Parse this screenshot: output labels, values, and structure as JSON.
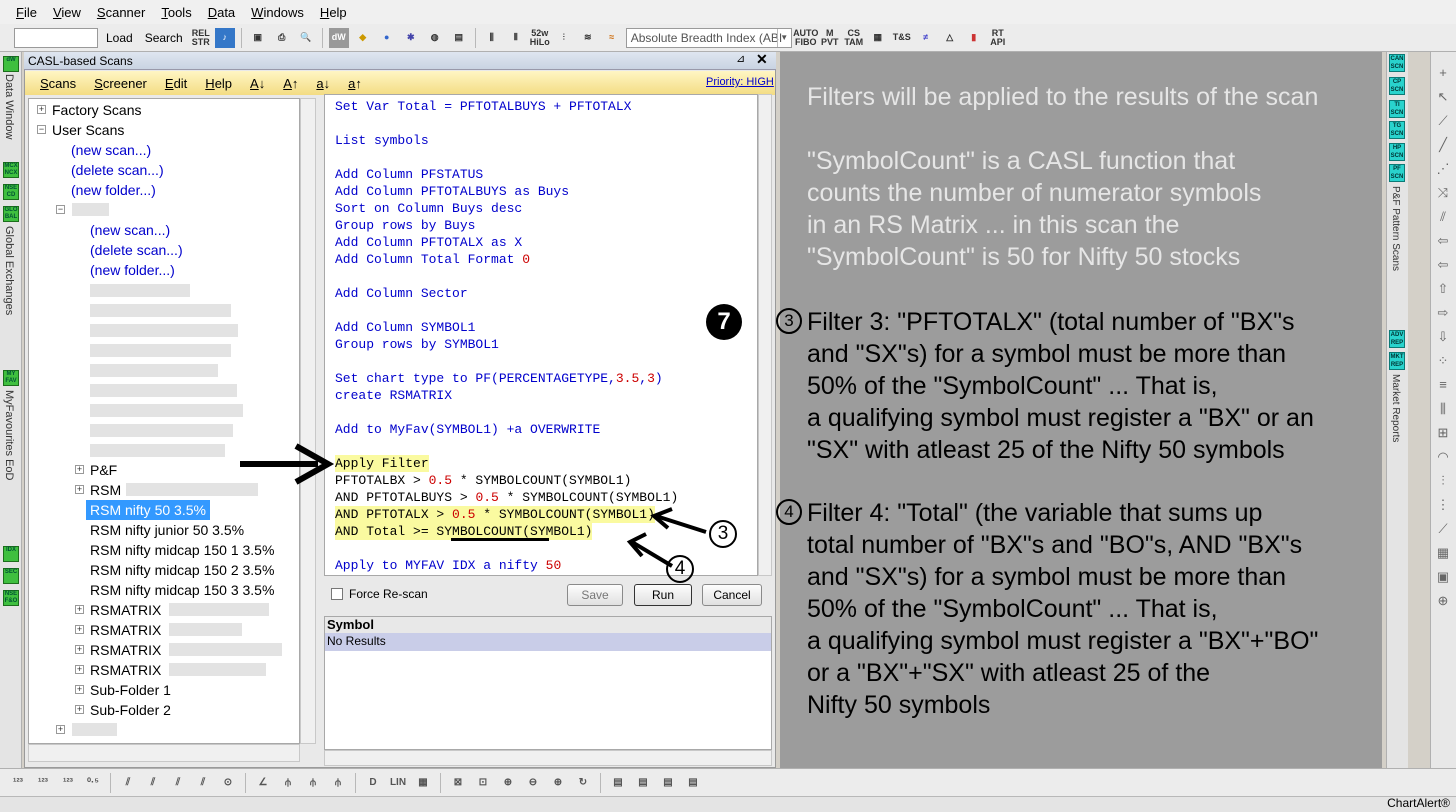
{
  "menu": [
    "File",
    "View",
    "Scanner",
    "Tools",
    "Data",
    "Windows",
    "Help"
  ],
  "toolbar": {
    "load": "Load",
    "search": "Search",
    "rel_str": "REL STR",
    "combo_value": "Absolute Breadth Index (ABI",
    "icons": [
      "dW",
      "52w HiLo",
      "AUTO FIBO",
      "M PVT",
      "CS TAM",
      "T&S",
      "RT API"
    ]
  },
  "left_rail": {
    "buttons": [
      "dW",
      "MCX NCX",
      "NSE CD",
      "GLO BAL",
      "MY FAV",
      "IDX",
      "SEC",
      "NSE F&O"
    ],
    "labels": [
      "Data Window",
      "Global Exchanges",
      "MyFavourites EoD"
    ]
  },
  "panel": {
    "title": "CASL-based Scans",
    "pin": "⊿",
    "close": "✕",
    "menu": [
      "Scans",
      "Screener",
      "Edit",
      "Help",
      "A↓",
      "A↑",
      "a↓",
      "a↑"
    ],
    "priority": "Priority: HIGH"
  },
  "tree": {
    "factory": "Factory Scans",
    "user": "User Scans",
    "new_scan": "(new scan...)",
    "delete_scan": "(delete scan...)",
    "new_folder": "(new folder...)",
    "pf": "P&F",
    "rsm": "RSM",
    "rsm_nifty50": "RSM nifty 50 3.5%",
    "rsm_jr": "RSM nifty junior 50 3.5%",
    "rsm_mid1": "RSM nifty midcap 150 1 3.5%",
    "rsm_mid2": "RSM nifty midcap 150 2 3.5%",
    "rsm_mid3": "RSM nifty midcap 150 3 3.5%",
    "rsmatrix": "RSMATRIX",
    "sub1": "Sub-Folder 1",
    "sub2": "Sub-Folder 2"
  },
  "code": {
    "l1": "Set Var Total = PFTOTALBUYS + PFTOTALX",
    "l2": "List symbols",
    "l3": "Add Column PFSTATUS",
    "l4": "Add Column PFTOTALBUYS as Buys",
    "l5": "Sort on Column Buys desc",
    "l6": "Group rows by Buys",
    "l7": "Add Column PFTOTALX as X",
    "l8": "Add Column Total Format 0",
    "l9": "Add Column Sector",
    "l10": "Add Column SYMBOL1",
    "l11": "Group rows by SYMBOL1",
    "l12": "Set chart type to PF(PERCENTAGETYPE,3.5,3)",
    "l13": "create RSMATRIX",
    "l14": "Add to MyFav(SYMBOL1) +a OVERWRITE",
    "l15": "Apply Filter",
    "l16": "PFTOTALBX > 0.5 * SYMBOLCOUNT(SYMBOL1)",
    "l17": "AND PFTOTALBUYS > 0.5 * SYMBOLCOUNT(SYMBOL1)",
    "l18": "AND PFTOTALX > 0.5 * SYMBOLCOUNT(SYMBOL1)",
    "l19": "AND Total >= SYMBOLCOUNT(SYMBOL1)",
    "l20": "Apply to MYFAV IDX a nifty 50"
  },
  "controls": {
    "force_rescan": "Force Re-scan",
    "save": "Save",
    "run": "Run",
    "cancel": "Cancel"
  },
  "results": {
    "header": "Symbol",
    "row": "No Results"
  },
  "annotation": {
    "step7": "7",
    "a1": "Filters will be applied to the results of the scan",
    "a2": "\"SymbolCount\" is a CASL function that",
    "a3": "counts the number of numerator symbols",
    "a4": "in an RS Matrix ... in this scan the",
    "a5": "\"SymbolCount\" is 50 for Nifty 50 stocks",
    "c3": "3",
    "f3a": "Filter 3: \"PFTOTALX\" (total number of \"BX\"s",
    "f3b": "and \"SX\"s) for a symbol must be more than",
    "f3c": "50% of the \"SymbolCount\" ... That is,",
    "f3d": "a qualifying symbol must register a \"BX\" or an",
    "f3e": "\"SX\" with atleast 25 of the Nifty 50 symbols",
    "c4": "4",
    "f4a": "Filter 4: \"Total\" (the variable that sums up",
    "f4b": "total number of \"BX\"s and \"BO\"s, AND \"BX\"s",
    "f4c": "and \"SX\"s) for a symbol must be more than",
    "f4d": "50% of the \"SymbolCount\" ... That is,",
    "f4e": "a qualifying symbol must register a \"BX\"+\"BO\"",
    "f4f": "or a \"BX\"+\"SX\" with atleast 25 of the",
    "f4g": "Nifty 50 symbols",
    "callout3": "3",
    "callout4": "4"
  },
  "right_rail": {
    "buttons": [
      "CAN SCN",
      "CP SCN",
      "TI SCN",
      "TG SCN",
      "HP SCN",
      "PF SCN",
      "ADV REP",
      "MKT REP"
    ],
    "labels": [
      "P&F Pattern Scans",
      "Market Reports"
    ]
  },
  "status": {
    "brand": "ChartAlert®"
  },
  "colors": {
    "annot_bg": "#9c9c9c",
    "selected": "#3399ff",
    "link": "#0000cc",
    "highlight": "#fafaa0"
  }
}
